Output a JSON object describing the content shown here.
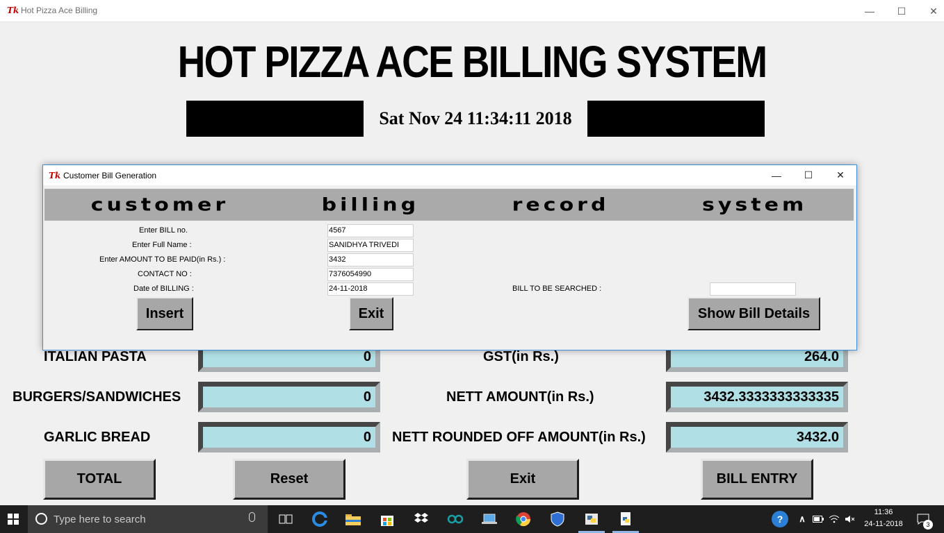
{
  "window": {
    "logo": "Tk",
    "title": "Hot Pizza Ace Billing",
    "min": "—",
    "max": "☐",
    "close": "✕"
  },
  "heading": "HOT PIZZA ACE BILLING SYSTEM",
  "clock": "Sat Nov 24 11:34:11 2018",
  "form": {
    "italian_pasta_label": "ITALIAN PASTA",
    "italian_pasta_value": "0",
    "burgers_label": "BURGERS/SANDWICHES",
    "burgers_value": "0",
    "garlic_bread_label": "GARLIC BREAD",
    "garlic_bread_value": "0",
    "gst_label": "GST(in Rs.)",
    "gst_value": "264.0",
    "nett_label": "NETT AMOUNT(in Rs.)",
    "nett_value": "3432.3333333333335",
    "rounded_label": "NETT ROUNDED OFF AMOUNT(in Rs.)",
    "rounded_value": "3432.0"
  },
  "buttons": {
    "total": "TOTAL",
    "reset": "Reset",
    "exit": "Exit",
    "bill_entry": "BILL ENTRY"
  },
  "dialog": {
    "logo": "Tk",
    "title": "Customer Bill Generation",
    "banner": [
      "CUSTOMER",
      "BILLING",
      "RECORD",
      "SYSTEM"
    ],
    "fields": [
      {
        "label": "Enter BILL no.",
        "value": "4567"
      },
      {
        "label": "Enter Full Name :",
        "value": "SANIDHYA TRIVEDI"
      },
      {
        "label": "Enter AMOUNT TO BE PAID(in Rs.) :",
        "value": "3432"
      },
      {
        "label": "CONTACT NO :",
        "value": "7376054990"
      },
      {
        "label": "Date of BILLING :",
        "value": "24-11-2018"
      }
    ],
    "search_label": "BILL TO BE SEARCHED :",
    "search_value": "",
    "insert": "Insert",
    "exit": "Exit",
    "show": "Show Bill Details"
  },
  "taskbar": {
    "search_placeholder": "Type here to search",
    "time": "11:36",
    "date": "24-11-2018",
    "notifications": "3",
    "icons": [
      "task-view",
      "edge",
      "file-explorer",
      "store",
      "dropbox",
      "arduino",
      "laptop",
      "chrome",
      "mcafee",
      "python-idle",
      "python-file"
    ]
  }
}
